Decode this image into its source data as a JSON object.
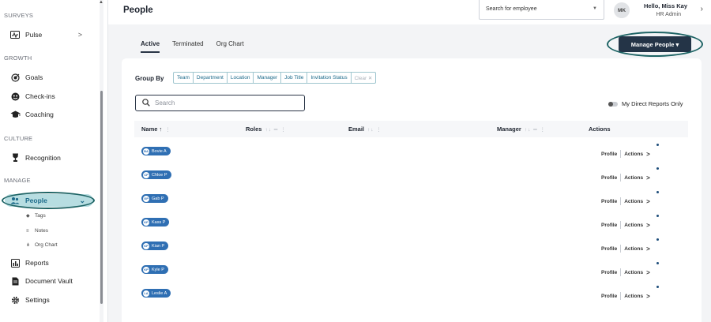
{
  "sidebar": {
    "sections": {
      "surveys": "SURVEYS",
      "growth": "GROWTH",
      "culture": "CULTURE",
      "manage": "MANAGE"
    },
    "items": {
      "pulse": {
        "label": "Pulse",
        "icon": "pulse-icon",
        "chevron": ">"
      },
      "goals": {
        "label": "Goals",
        "icon": "goals-icon"
      },
      "checkins": {
        "label": "Check-ins",
        "icon": "checkins-icon"
      },
      "coaching": {
        "label": "Coaching",
        "icon": "coaching-icon"
      },
      "recognition": {
        "label": "Recognition",
        "icon": "trophy-icon"
      },
      "people": {
        "label": "People",
        "icon": "people-icon",
        "chevron": "⌄"
      },
      "reports": {
        "label": "Reports",
        "icon": "reports-icon"
      },
      "vault": {
        "label": "Document Vault",
        "icon": "document-icon"
      },
      "settings": {
        "label": "Settings",
        "icon": "gear-icon"
      }
    },
    "sub_items": {
      "tags": {
        "label": "Tags",
        "icon": "tag-icon"
      },
      "notes": {
        "label": "Notes",
        "icon": "notes-icon"
      },
      "org_chart": {
        "label": "Org Chart",
        "icon": "org-chart-icon"
      }
    }
  },
  "header": {
    "title": "People",
    "employee_search": {
      "value": "Search for employee"
    },
    "user": {
      "initials": "MK",
      "greeting": "Hello, Miss Kay",
      "role": "HR Admin"
    }
  },
  "main": {
    "tabs": [
      {
        "label": "Active",
        "active": true
      },
      {
        "label": "Terminated",
        "active": false
      },
      {
        "label": "Org Chart",
        "active": false
      }
    ],
    "manage_button": "Manage People ▾",
    "group_by": {
      "label": "Group By",
      "options": [
        "Team",
        "Department",
        "Location",
        "Manager",
        "Job Title",
        "Invitation Status"
      ],
      "clear": "Clear ✕"
    },
    "search": {
      "placeholder": "Search"
    },
    "direct_reports_toggle": "My Direct Reports Only",
    "columns": {
      "name": "Name ↑",
      "roles": "Roles",
      "email": "Email",
      "manager": "Manager",
      "actions": "Actions"
    },
    "rows": [
      {
        "initials": "BA",
        "name": "Bovie A"
      },
      {
        "initials": "CP",
        "name": "Chloe P"
      },
      {
        "initials": "GP",
        "name": "Gab P"
      },
      {
        "initials": "KP",
        "name": "Kass P"
      },
      {
        "initials": "KP",
        "name": "Kian P"
      },
      {
        "initials": "KP",
        "name": "Kyle P"
      },
      {
        "initials": "LA",
        "name": "Leslie A"
      }
    ],
    "row_actions": {
      "profile": "Profile",
      "actions": "Actions",
      "chevron": ">"
    }
  },
  "colors": {
    "accent": "#243447",
    "highlight": "#b7dde1",
    "annotation_ring": "#1d6364",
    "pill": "#2f6fb3"
  }
}
